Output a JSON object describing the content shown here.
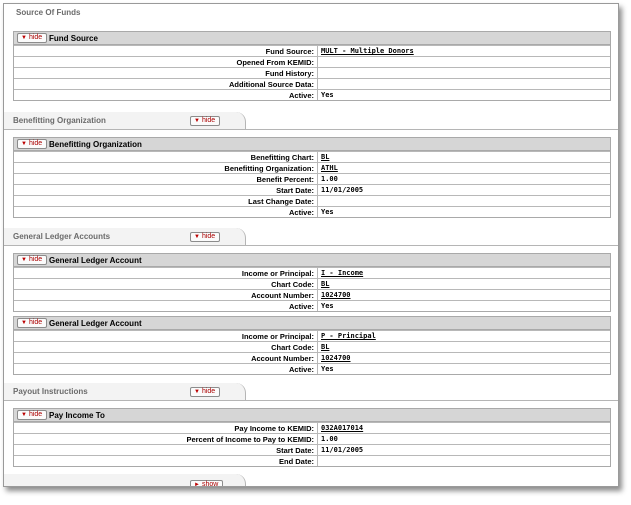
{
  "source_of_funds": {
    "title": "Source Of Funds",
    "panel_title": "Fund Source",
    "toggle": "hide",
    "rows": [
      {
        "label": "Fund Source:",
        "value": "MULT - Multiple Donors",
        "link": true
      },
      {
        "label": "Opened From KEMID:",
        "value": "",
        "link": false
      },
      {
        "label": "Fund History:",
        "value": "",
        "link": false
      },
      {
        "label": "Additional Source Data:",
        "value": "",
        "link": false
      },
      {
        "label": "Active:",
        "value": "Yes",
        "link": false
      }
    ]
  },
  "benefitting": {
    "title": "Benefitting Organization",
    "tab_toggle": "hide",
    "panel_title": "Benefitting Organization",
    "toggle": "hide",
    "rows": [
      {
        "label": "Benefitting Chart:",
        "value": "BL",
        "link": true
      },
      {
        "label": "Benefitting Organization:",
        "value": "ATHL",
        "link": true
      },
      {
        "label": "Benefit Percent:",
        "value": "1.00",
        "link": false
      },
      {
        "label": "Start Date:",
        "value": "11/01/2005",
        "link": false
      },
      {
        "label": "Last Change Date:",
        "value": "",
        "link": false
      },
      {
        "label": "Active:",
        "value": "Yes",
        "link": false
      }
    ]
  },
  "gl_accounts": {
    "title": "General Ledger Accounts",
    "tab_toggle": "hide",
    "panels": [
      {
        "panel_title": "General Ledger Account",
        "toggle": "hide",
        "rows": [
          {
            "label": "Income or Principal:",
            "value": "I - Income",
            "link": true
          },
          {
            "label": "Chart Code:",
            "value": "BL",
            "link": true
          },
          {
            "label": "Account Number:",
            "value": "1024700",
            "link": true
          },
          {
            "label": "Active:",
            "value": "Yes",
            "link": false
          }
        ]
      },
      {
        "panel_title": "General Ledger Account",
        "toggle": "hide",
        "rows": [
          {
            "label": "Income or Principal:",
            "value": "P - Principal",
            "link": true
          },
          {
            "label": "Chart Code:",
            "value": "BL",
            "link": true
          },
          {
            "label": "Account Number:",
            "value": "1024700",
            "link": true
          },
          {
            "label": "Active:",
            "value": "Yes",
            "link": false
          }
        ]
      }
    ]
  },
  "payout": {
    "title": "Payout Instructions",
    "tab_toggle": "hide",
    "panel_title": "Pay Income To",
    "toggle": "hide",
    "rows": [
      {
        "label": "Pay Income to KEMID:",
        "value": "032A017014",
        "link": true
      },
      {
        "label": "Percent of Income to Pay to KEMID:",
        "value": "1.00",
        "link": false
      },
      {
        "label": "Start Date:",
        "value": "11/01/2005",
        "link": false
      },
      {
        "label": "End Date:",
        "value": "",
        "link": false
      }
    ]
  },
  "footer": {
    "toggle": "show"
  }
}
